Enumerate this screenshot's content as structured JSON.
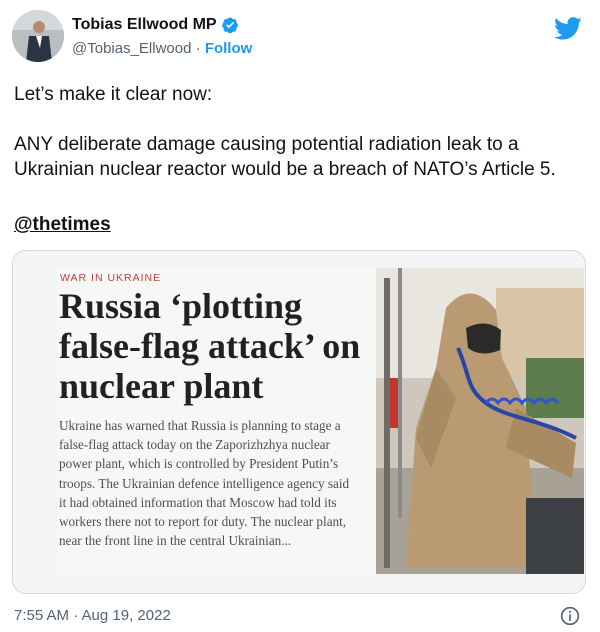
{
  "author": {
    "name": "Tobias Ellwood MP",
    "handle": "@Tobias_Ellwood",
    "separator": " · ",
    "follow_label": "Follow",
    "verified_icon": "verified-badge-icon"
  },
  "brand": {
    "icon": "twitter-bird-icon",
    "color": "#1d9bf0"
  },
  "tweet": {
    "line1": "Let’s make it clear now:",
    "line2": "ANY deliberate damage causing potential radiation leak to a Ukrainian nuclear reactor would be a breach of NATO’s Article 5.",
    "mention": "@thetimes"
  },
  "card": {
    "kicker": "WAR IN UKRAINE",
    "headline": "Russia ‘plotting false-flag attack’ on nuclear plant",
    "body": "Ukraine has warned that Russia is planning to stage a false-flag attack today on the Zaporizhzhya nuclear power plant, which is controlled by President Putin’s troops. The Ukrainian defence intelligence agency said it had obtained information that Moscow had told its workers there not to report for duty. The nuclear plant, near the front line in the central Ukrainian...",
    "kicker_color": "#b8413a"
  },
  "footer": {
    "timestamp": "7:55 AM · Aug 19, 2022",
    "info_icon": "info-icon"
  }
}
